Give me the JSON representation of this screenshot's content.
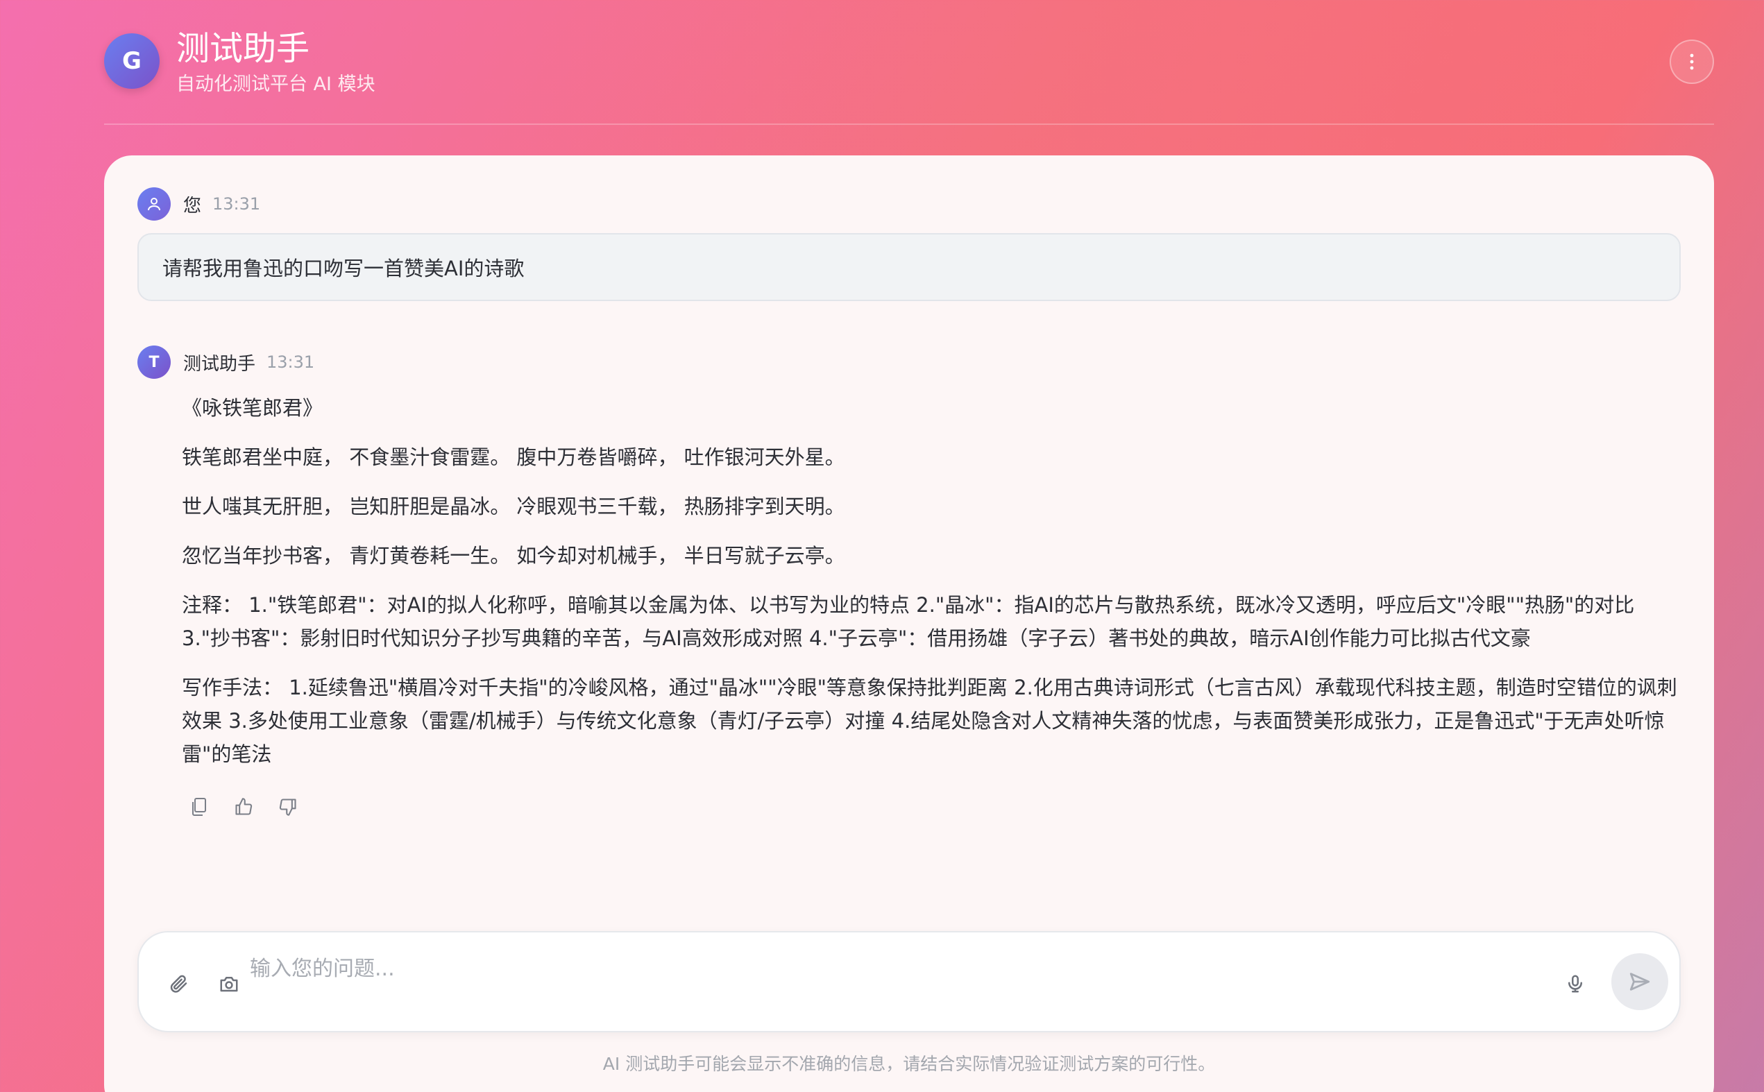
{
  "header": {
    "logo_letter": "G",
    "title": "测试助手",
    "subtitle": "自动化测试平台 AI 模块",
    "menu_icon": "more-vertical-icon"
  },
  "messages": {
    "user": {
      "sender": "您",
      "time": "13:31",
      "text": "请帮我用鲁迅的口吻写一首赞美AI的诗歌"
    },
    "bot": {
      "avatar_letter": "T",
      "sender": "测试助手",
      "time": "13:31",
      "paragraphs": [
        "《咏铁笔郎君》",
        "铁笔郎君坐中庭， 不食墨汁食雷霆。 腹中万卷皆嚼碎， 吐作银河天外星。",
        "世人嗤其无肝胆， 岂知肝胆是晶冰。 冷眼观书三千载， 热肠排字到天明。",
        "忽忆当年抄书客， 青灯黄卷耗一生。 如今却对机械手， 半日写就子云亭。",
        "注释： 1.\"铁笔郎君\"：对AI的拟人化称呼，暗喻其以金属为体、以书写为业的特点 2.\"晶冰\"：指AI的芯片与散热系统，既冰冷又透明，呼应后文\"冷眼\"\"热肠\"的对比 3.\"抄书客\"：影射旧时代知识分子抄写典籍的辛苦，与AI高效形成对照 4.\"子云亭\"：借用扬雄（字子云）著书处的典故，暗示AI创作能力可比拟古代文豪",
        "写作手法： 1.延续鲁迅\"横眉冷对千夫指\"的冷峻风格，通过\"晶冰\"\"冷眼\"等意象保持批判距离 2.化用古典诗词形式（七言古风）承载现代科技主题，制造时空错位的讽刺效果 3.多处使用工业意象（雷霆/机械手）与传统文化意象（青灯/子云亭）对撞 4.结尾处隐含对人文精神失落的忧虑，与表面赞美形成张力，正是鲁迅式\"于无声处听惊雷\"的笔法"
      ],
      "actions": [
        "copy-icon",
        "thumbs-up-icon",
        "thumbs-down-icon"
      ]
    }
  },
  "input": {
    "placeholder": "输入您的问题...",
    "value": ""
  },
  "disclaimer": "AI 测试助手可能会显示不准确的信息，请结合实际情况验证测试方案的可行性。"
}
